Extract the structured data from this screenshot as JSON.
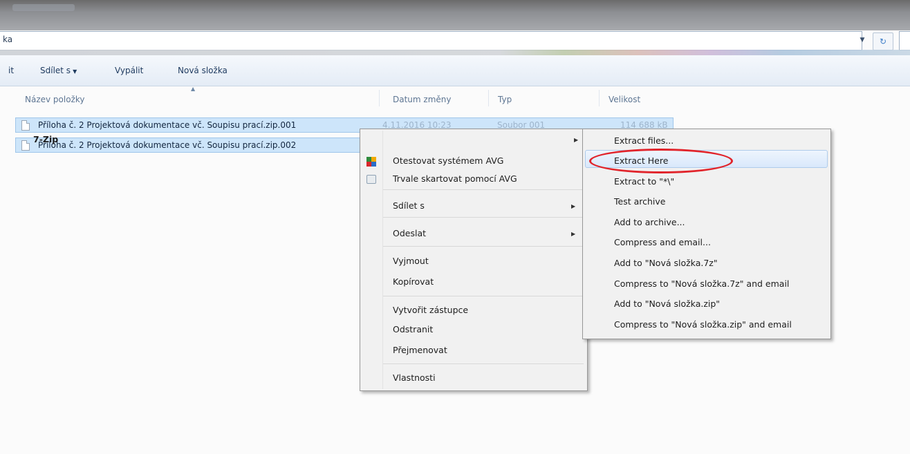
{
  "address": {
    "text": "ka"
  },
  "toolbar": {
    "partial_label": "it",
    "share_label": "Sdílet s",
    "burn_label": "Vypálit",
    "new_folder_label": "Nová složka"
  },
  "columns": {
    "name": "Název položky",
    "date": "Datum změny",
    "type": "Typ",
    "size": "Velikost"
  },
  "files": [
    {
      "name": "Příloha č. 2 Projektová dokumentace vč. Soupisu prací.zip.001",
      "date": "4.11.2016 10:23",
      "type": "Soubor 001",
      "size": "114 688 kB"
    },
    {
      "name": "Příloha č. 2 Projektová dokumentace vč. Soupisu prací.zip.002",
      "date": "",
      "type": "",
      "size": ""
    }
  ],
  "context_menu": {
    "zip": "7-Zip",
    "avg_test": "Otestovat systémem AVG",
    "avg_shred": "Trvale skartovat pomocí AVG",
    "share": "Sdílet s",
    "send": "Odeslat",
    "cut": "Vyjmout",
    "copy": "Kopírovat",
    "shortcut": "Vytvořit zástupce",
    "delete": "Odstranit",
    "rename": "Přejmenovat",
    "properties": "Vlastnosti"
  },
  "submenu": {
    "extract_files": "Extract files...",
    "extract_here": "Extract Here",
    "extract_to": "Extract to \"*\\\"",
    "test_archive": "Test archive",
    "add_to_archive": "Add to archive...",
    "compress_email": "Compress and email...",
    "add_7z": "Add to \"Nová složka.7z\"",
    "compress_7z_email": "Compress to \"Nová složka.7z\" and email",
    "add_zip": "Add to \"Nová složka.zip\"",
    "compress_zip_email": "Compress to \"Nová složka.zip\" and email"
  },
  "highlight_color": "#e1242b"
}
